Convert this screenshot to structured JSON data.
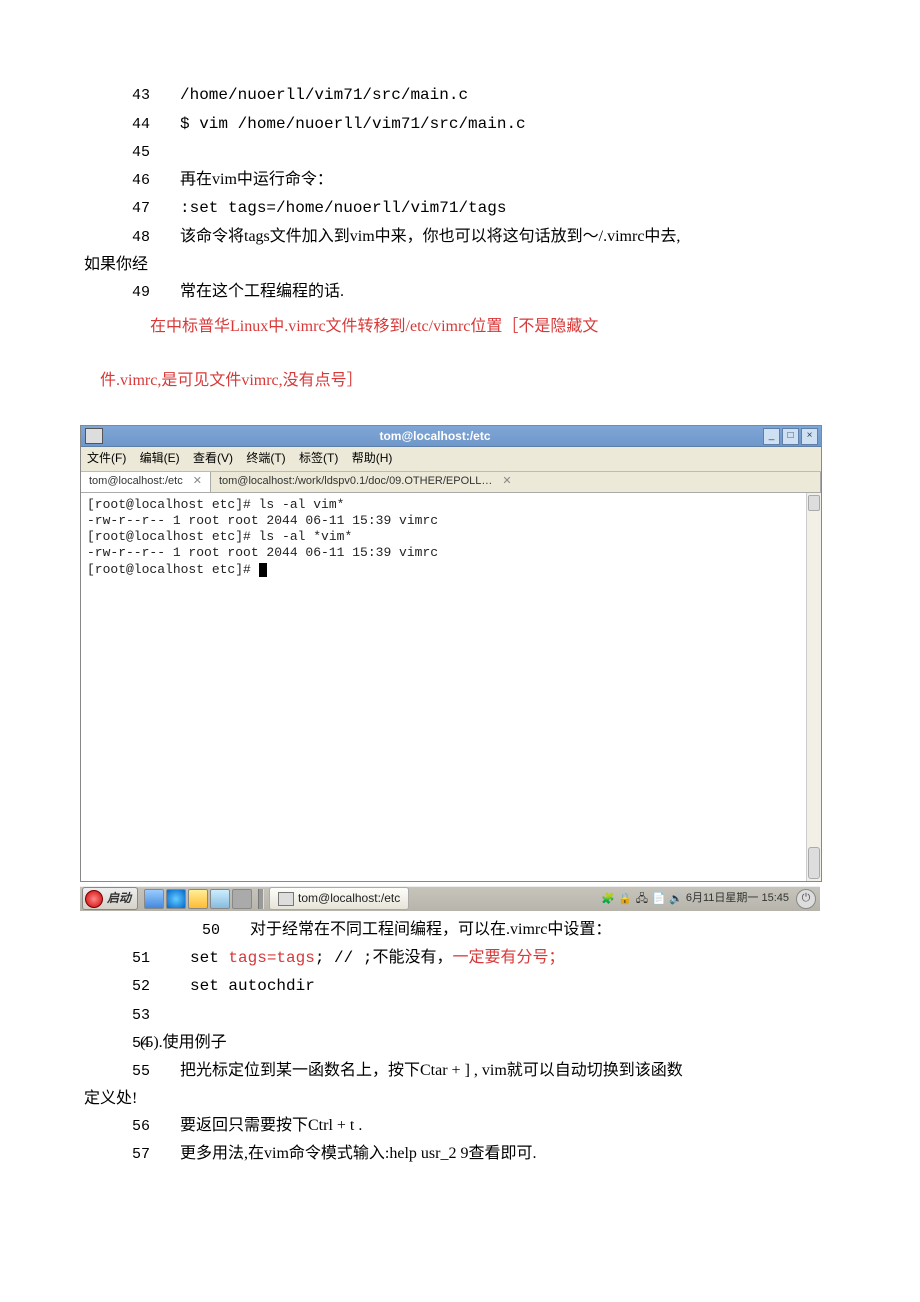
{
  "doc": {
    "l43": "/home/nuoerll/vim71/src/main.c",
    "l44": "$ vim /home/nuoerll/vim71/src/main.c",
    "l45": "",
    "l46": "再在vim中运行命令：",
    "l47": ":set tags=/home/nuoerll/vim71/tags",
    "l48a": "该命令将tags文件加入到vim中来，你也可以将这句话放到～/.vimrc中去,",
    "l48wrap": "如果你经",
    "l49": "常在这个工程编程的话.",
    "note_red_a": "在中标普华Linux中.vimrc文件转移到/etc/vimrc位置［不是隐藏文",
    "note_red_b": "件.vimrc,是可见文件vimrc,没有点号］",
    "l50": "对于经常在不同工程间编程，可以在.vimrc中设置：",
    "l51_pre": "set ",
    "l51_red": "tags=tags",
    "l51_post": "; // ;不能没有，",
    "l51_red2": "一定要有分号；",
    "l52": "set autochdir",
    "l53": "",
    "l54": "(5).使用例子",
    "l55a": "把光标定位到某一函数名上，按下Ctar + ] , vim就可以自动切换到该函数",
    "l55wrap": "定义处!",
    "l56": "要返回只需要按下Ctrl + t .",
    "l57": "更多用法,在vim命令模式输入:help usr_2 9查看即可."
  },
  "linenos": {
    "n43": "43",
    "n44": "44",
    "n45": "45",
    "n46": "46",
    "n47": "47",
    "n48": "48",
    "n49": "49",
    "n50": "50",
    "n51": "51",
    "n52": "52",
    "n53": "53",
    "n54": "54",
    "n55": "55",
    "n56": "56",
    "n57": "57"
  },
  "terminal": {
    "title": "tom@localhost:/etc",
    "menu": {
      "file": "文件(F)",
      "edit": "编辑(E)",
      "view": "查看(V)",
      "terminal": "终端(T)",
      "tabs": "标签(T)",
      "help": "帮助(H)"
    },
    "tabs": {
      "tab1": "tom@localhost:/etc",
      "tab2": "tom@localhost:/work/ldspv0.1/doc/09.OTHER/EPOLL…"
    },
    "close_x": "✕",
    "lines": {
      "l1": "[root@localhost etc]# ls -al vim*",
      "l2": "-rw-r--r-- 1 root root 2044 06-11 15:39 vimrc",
      "l3": "[root@localhost etc]# ls -al *vim*",
      "l4": "-rw-r--r-- 1 root root 2044 06-11 15:39 vimrc",
      "l5": "[root@localhost etc]# "
    },
    "winbtn": {
      "min": "_",
      "max": "□",
      "close": "×"
    }
  },
  "taskbar": {
    "start": "启动",
    "task_label": "tom@localhost:/etc",
    "clock": "6月11日星期一 15:45",
    "power": "⏻"
  }
}
